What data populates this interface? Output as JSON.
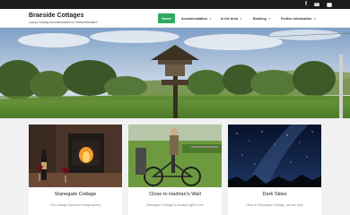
{
  "social": {
    "facebook_glyph": "f",
    "email_icon": "envelope-icon",
    "contact_icon": "phone-icon"
  },
  "site": {
    "title": "Braeside Cottages",
    "tagline": "Luxury Holiday Accommodation in Northumberland"
  },
  "nav": [
    {
      "label": "Home",
      "active": true
    },
    {
      "label": "Accommodation",
      "has_dropdown": true
    },
    {
      "label": "In the Area",
      "has_dropdown": true
    },
    {
      "label": "Booking",
      "has_dropdown": true
    },
    {
      "label": "Further Information",
      "has_dropdown": true
    }
  ],
  "cards": [
    {
      "title": "Stanegate Cottage",
      "text": "The cottage has been imaginatively"
    },
    {
      "title": "Close to Hadrian's Wall",
      "text": "Stanegate Cottage is located right in the"
    },
    {
      "title": "Dark Skies",
      "text": "Here at Stanegate Cottage, we are very"
    }
  ],
  "colors": {
    "accent": "#2eaa63",
    "topbar": "#1c1c1c",
    "background": "#f1f1f1"
  }
}
